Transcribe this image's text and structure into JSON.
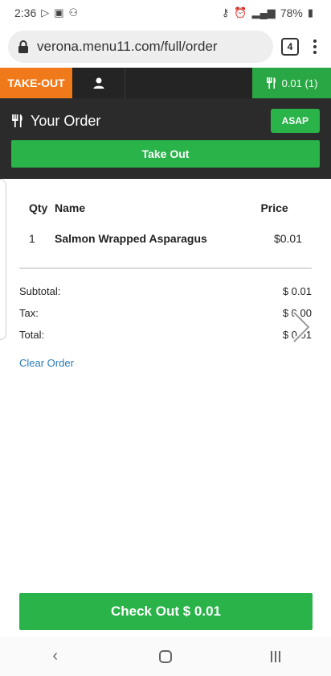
{
  "status_bar": {
    "time": "2:36",
    "battery": "78%"
  },
  "browser": {
    "url": "verona.menu11.com/full/order",
    "tab_count": "4"
  },
  "app_nav": {
    "takeout_label": "TAKE-OUT",
    "cart_label": "0.01 (1)"
  },
  "order_header": {
    "title": "Your Order",
    "asap_label": "ASAP",
    "takeout_label": "Take Out"
  },
  "table": {
    "headers": {
      "qty": "Qty",
      "name": "Name",
      "price": "Price"
    },
    "rows": [
      {
        "qty": "1",
        "name": "Salmon Wrapped Asparagus",
        "price": "$0.01"
      }
    ]
  },
  "totals": {
    "subtotal_label": "Subtotal:",
    "subtotal_value": "$ 0.01",
    "tax_label": "Tax:",
    "tax_value": "$ 0.00",
    "total_label": "Total:",
    "total_value": "$ 0.01"
  },
  "clear_label": "Clear Order",
  "checkout_label": "Check Out $ 0.01",
  "colors": {
    "accent_orange": "#f07a19",
    "accent_green": "#29b349",
    "dark_bg": "#2b2b2b",
    "link_blue": "#2a7ab8"
  }
}
